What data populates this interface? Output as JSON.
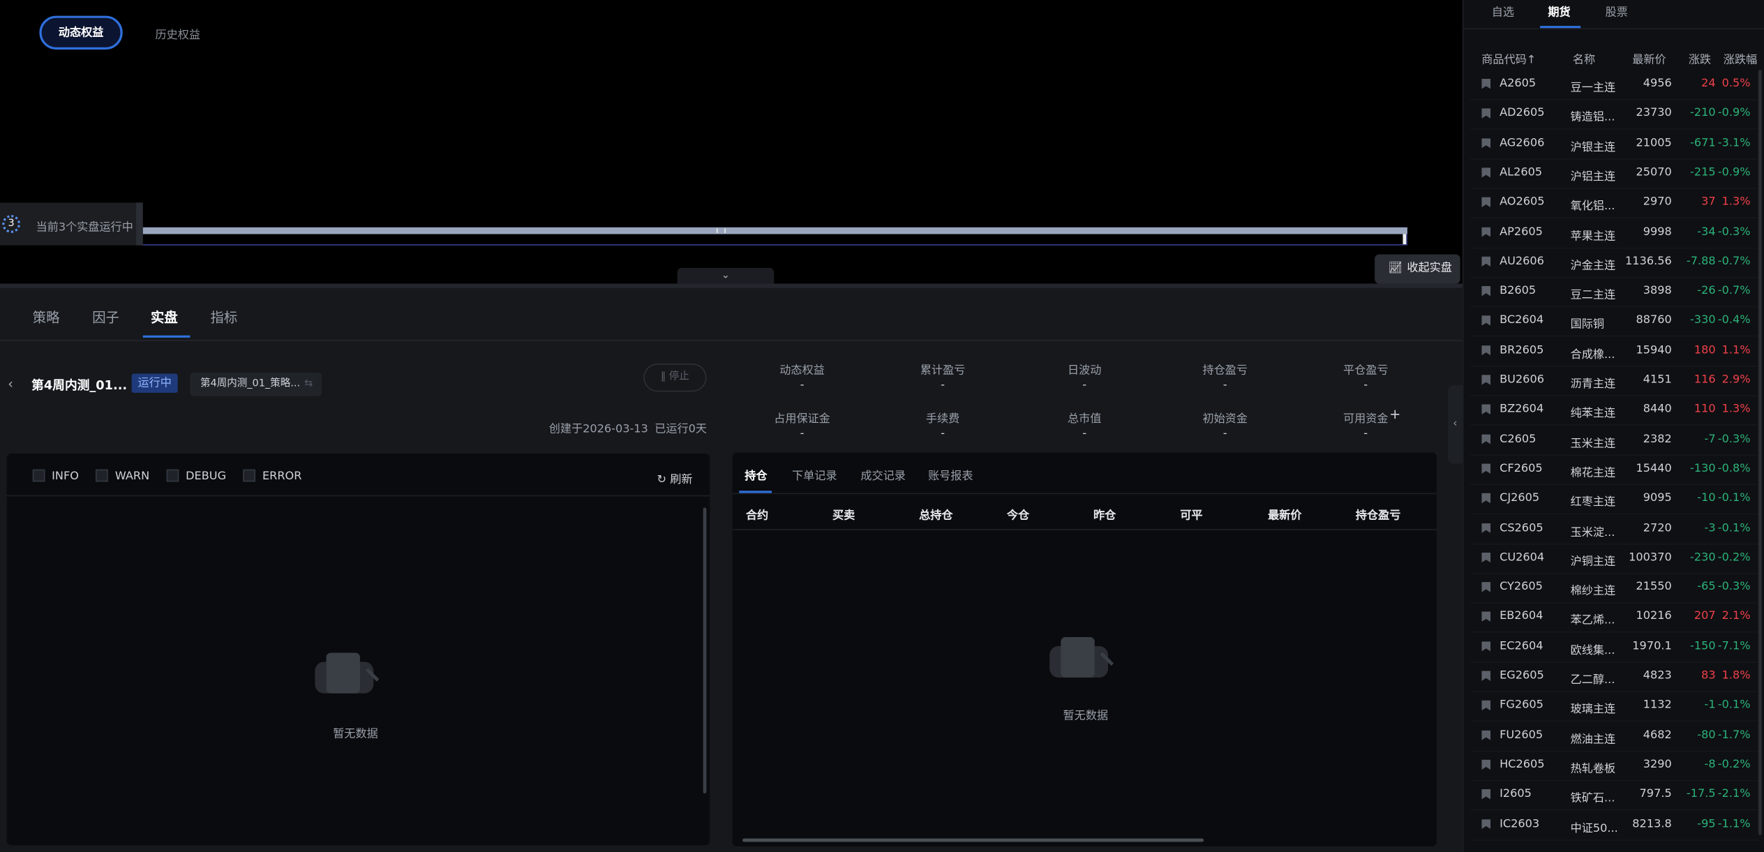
{
  "equity_tabs": {
    "active": "动态权益",
    "other": "历史权益"
  },
  "running_badge": {
    "count": "3",
    "text": "当前3个实盘运行中"
  },
  "collapse_button": "收起实盘",
  "bottom_tabs": [
    {
      "label": "策略"
    },
    {
      "label": "因子"
    },
    {
      "label": "实盘"
    },
    {
      "label": "指标"
    }
  ],
  "instance": {
    "name": "第4周内测_01...",
    "status": "运行中",
    "strategy_select": "第4周内测_01_策略...",
    "stop_button": "停止",
    "created": "创建于2026-03-13",
    "uptime": "已运行0天"
  },
  "stats": [
    {
      "label": "动态权益",
      "value": "-"
    },
    {
      "label": "累计盈亏",
      "value": "-"
    },
    {
      "label": "日波动",
      "value": "-"
    },
    {
      "label": "持仓盈亏",
      "value": "-"
    },
    {
      "label": "平仓盈亏",
      "value": "-"
    },
    {
      "label": "占用保证金",
      "value": "-"
    },
    {
      "label": "手续费",
      "value": "-"
    },
    {
      "label": "总市值",
      "value": "-"
    },
    {
      "label": "初始资金",
      "value": "-"
    },
    {
      "label": "可用资金",
      "value": "-"
    }
  ],
  "log_panel": {
    "filters": [
      "INFO",
      "WARN",
      "DEBUG",
      "ERROR"
    ],
    "refresh": "刷新",
    "empty": "暂无数据"
  },
  "positions_panel": {
    "tabs": [
      "持仓",
      "下单记录",
      "成交记录",
      "账号报表"
    ],
    "columns": [
      "合约",
      "买卖",
      "总持仓",
      "今仓",
      "昨仓",
      "可平",
      "最新价",
      "持仓盈亏"
    ],
    "empty": "暂无数据"
  },
  "market": {
    "tabs": [
      "自选",
      "期货",
      "股票"
    ],
    "active_tab": "期货",
    "columns": [
      "商品代码↑",
      "名称",
      "最新价",
      "涨跌",
      "涨跌幅"
    ],
    "rows": [
      {
        "code": "A2605",
        "name": "豆一主连",
        "price": "4956",
        "chg": "24",
        "pct": "0.5%",
        "dir": "up"
      },
      {
        "code": "AD2605",
        "name": "铸造铝...",
        "price": "23730",
        "chg": "-210",
        "pct": "-0.9%",
        "dir": "down"
      },
      {
        "code": "AG2606",
        "name": "沪银主连",
        "price": "21005",
        "chg": "-671",
        "pct": "-3.1%",
        "dir": "down"
      },
      {
        "code": "AL2605",
        "name": "沪铝主连",
        "price": "25070",
        "chg": "-215",
        "pct": "-0.9%",
        "dir": "down"
      },
      {
        "code": "AO2605",
        "name": "氧化铝...",
        "price": "2970",
        "chg": "37",
        "pct": "1.3%",
        "dir": "up"
      },
      {
        "code": "AP2605",
        "name": "苹果主连",
        "price": "9998",
        "chg": "-34",
        "pct": "-0.3%",
        "dir": "down"
      },
      {
        "code": "AU2606",
        "name": "沪金主连",
        "price": "1136.56",
        "chg": "-7.88",
        "pct": "-0.7%",
        "dir": "down"
      },
      {
        "code": "B2605",
        "name": "豆二主连",
        "price": "3898",
        "chg": "-26",
        "pct": "-0.7%",
        "dir": "down"
      },
      {
        "code": "BC2604",
        "name": "国际铜",
        "price": "88760",
        "chg": "-330",
        "pct": "-0.4%",
        "dir": "down"
      },
      {
        "code": "BR2605",
        "name": "合成橡...",
        "price": "15940",
        "chg": "180",
        "pct": "1.1%",
        "dir": "up"
      },
      {
        "code": "BU2606",
        "name": "沥青主连",
        "price": "4151",
        "chg": "116",
        "pct": "2.9%",
        "dir": "up"
      },
      {
        "code": "BZ2604",
        "name": "纯苯主连",
        "price": "8440",
        "chg": "110",
        "pct": "1.3%",
        "dir": "up"
      },
      {
        "code": "C2605",
        "name": "玉米主连",
        "price": "2382",
        "chg": "-7",
        "pct": "-0.3%",
        "dir": "down"
      },
      {
        "code": "CF2605",
        "name": "棉花主连",
        "price": "15440",
        "chg": "-130",
        "pct": "-0.8%",
        "dir": "down"
      },
      {
        "code": "CJ2605",
        "name": "红枣主连",
        "price": "9095",
        "chg": "-10",
        "pct": "-0.1%",
        "dir": "down"
      },
      {
        "code": "CS2605",
        "name": "玉米淀...",
        "price": "2720",
        "chg": "-3",
        "pct": "-0.1%",
        "dir": "down"
      },
      {
        "code": "CU2604",
        "name": "沪铜主连",
        "price": "100370",
        "chg": "-230",
        "pct": "-0.2%",
        "dir": "down"
      },
      {
        "code": "CY2605",
        "name": "棉纱主连",
        "price": "21550",
        "chg": "-65",
        "pct": "-0.3%",
        "dir": "down"
      },
      {
        "code": "EB2604",
        "name": "苯乙烯...",
        "price": "10216",
        "chg": "207",
        "pct": "2.1%",
        "dir": "up"
      },
      {
        "code": "EC2604",
        "name": "欧线集...",
        "price": "1970.1",
        "chg": "-150",
        "pct": "-7.1%",
        "dir": "down"
      },
      {
        "code": "EG2605",
        "name": "乙二醇...",
        "price": "4823",
        "chg": "83",
        "pct": "1.8%",
        "dir": "up"
      },
      {
        "code": "FG2605",
        "name": "玻璃主连",
        "price": "1132",
        "chg": "-1",
        "pct": "-0.1%",
        "dir": "down"
      },
      {
        "code": "FU2605",
        "name": "燃油主连",
        "price": "4682",
        "chg": "-80",
        "pct": "-1.7%",
        "dir": "down"
      },
      {
        "code": "HC2605",
        "name": "热轧卷板",
        "price": "3290",
        "chg": "-8",
        "pct": "-0.2%",
        "dir": "down"
      },
      {
        "code": "I2605",
        "name": "铁矿石...",
        "price": "797.5",
        "chg": "-17.5",
        "pct": "-2.1%",
        "dir": "down"
      },
      {
        "code": "IC2603",
        "name": "中证50...",
        "price": "8213.8",
        "chg": "-95",
        "pct": "-1.1%",
        "dir": "down"
      }
    ]
  }
}
